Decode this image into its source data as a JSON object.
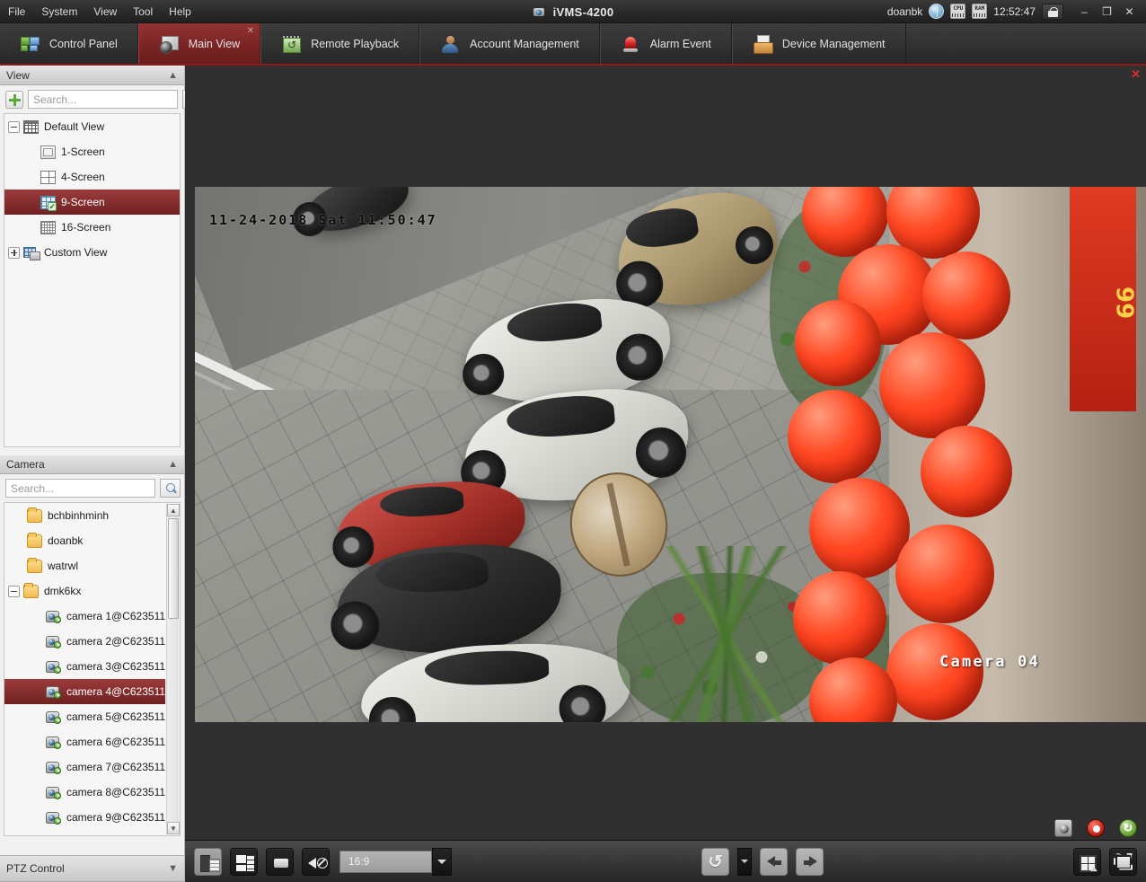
{
  "titlebar": {
    "menus": [
      {
        "label": "File"
      },
      {
        "label": "System"
      },
      {
        "label": "View"
      },
      {
        "label": "Tool"
      },
      {
        "label": "Help"
      }
    ],
    "app_title": "iVMS-4200",
    "logo_icon": "camera-logo-icon",
    "user": "doanbk",
    "status_icons": [
      "globe-icon",
      "cpu-icon",
      "ram-icon"
    ],
    "cpu_label": "CPU",
    "ram_label": "RAM",
    "clock": "12:52:47",
    "lock_icon": "lock-icon",
    "minimize": "–",
    "restore": "❐",
    "close": "✕"
  },
  "tabs": [
    {
      "label": "Control Panel",
      "icon": "control-panel-icon",
      "active": false,
      "closable": false
    },
    {
      "label": "Main View",
      "icon": "main-view-icon",
      "active": true,
      "closable": true,
      "close_glyph": "✕"
    },
    {
      "label": "Remote Playback",
      "icon": "remote-playback-icon",
      "active": false,
      "closable": false
    },
    {
      "label": "Account Management",
      "icon": "account-management-icon",
      "active": false,
      "closable": false
    },
    {
      "label": "Alarm Event",
      "icon": "alarm-event-icon",
      "active": false,
      "closable": false
    },
    {
      "label": "Device Management",
      "icon": "device-management-icon",
      "active": false,
      "closable": false
    }
  ],
  "view_panel": {
    "title": "View",
    "collapse_icon": "chevron-up-icon",
    "add_button_icon": "plus-icon",
    "search_placeholder": "Search...",
    "search_value": "",
    "search_icon": "magnifier-icon",
    "tree": [
      {
        "label": "Default View",
        "icon": "view-grid-icon",
        "expander": "minus",
        "depth": 0,
        "selected": false
      },
      {
        "label": "1-Screen",
        "icon": "screen-1-icon",
        "expander": "none",
        "depth": 1,
        "selected": false
      },
      {
        "label": "4-Screen",
        "icon": "screen-4-icon",
        "expander": "none",
        "depth": 1,
        "selected": false
      },
      {
        "label": "9-Screen",
        "icon": "screen-9-icon",
        "expander": "none",
        "depth": 1,
        "selected": true
      },
      {
        "label": "16-Screen",
        "icon": "screen-16-icon",
        "expander": "none",
        "depth": 1,
        "selected": false
      },
      {
        "label": "Custom View",
        "icon": "custom-view-icon",
        "expander": "plus",
        "depth": 0,
        "selected": false
      }
    ]
  },
  "camera_panel": {
    "title": "Camera",
    "collapse_icon": "chevron-up-icon",
    "search_placeholder": "Search...",
    "search_value": "",
    "search_icon": "magnifier-icon",
    "scroll_up_glyph": "▲",
    "scroll_down_glyph": "▼",
    "tree": [
      {
        "label": "bchbinhminh",
        "icon": "folder-icon",
        "expander": "none",
        "depth": 1,
        "selected": false
      },
      {
        "label": "doanbk",
        "icon": "folder-icon",
        "expander": "none",
        "depth": 1,
        "selected": false
      },
      {
        "label": "watrwl",
        "icon": "folder-icon",
        "expander": "none",
        "depth": 1,
        "selected": false
      },
      {
        "label": "dmk6kx",
        "icon": "folder-icon",
        "expander": "minus",
        "depth": 0,
        "selected": false
      },
      {
        "label": "camera 1@C623511...",
        "icon": "camera-icon",
        "expander": "none",
        "depth": 2,
        "selected": false
      },
      {
        "label": "camera 2@C623511...",
        "icon": "camera-icon",
        "expander": "none",
        "depth": 2,
        "selected": false
      },
      {
        "label": "camera 3@C623511...",
        "icon": "camera-icon",
        "expander": "none",
        "depth": 2,
        "selected": false
      },
      {
        "label": "camera 4@C623511...",
        "icon": "camera-icon",
        "expander": "none",
        "depth": 2,
        "selected": true
      },
      {
        "label": "camera 5@C623511...",
        "icon": "camera-icon",
        "expander": "none",
        "depth": 2,
        "selected": false
      },
      {
        "label": "camera 6@C623511...",
        "icon": "camera-icon",
        "expander": "none",
        "depth": 2,
        "selected": false
      },
      {
        "label": "camera 7@C623511...",
        "icon": "camera-icon",
        "expander": "none",
        "depth": 2,
        "selected": false
      },
      {
        "label": "camera 8@C623511...",
        "icon": "camera-icon",
        "expander": "none",
        "depth": 2,
        "selected": false
      },
      {
        "label": "camera 9@C623511...",
        "icon": "camera-icon",
        "expander": "none",
        "depth": 2,
        "selected": false
      }
    ]
  },
  "ptz_panel": {
    "title": "PTZ Control",
    "expand_icon": "chevron-down-icon"
  },
  "video": {
    "close_glyph": "✕",
    "timestamp": "11-24-2018 Sat 11:50:47",
    "camera_label": "Camera 04",
    "banner_text": "99",
    "overlay_tools": [
      {
        "icon": "capture-icon"
      },
      {
        "icon": "record-icon"
      },
      {
        "icon": "ptz-icon",
        "glyph": "↻"
      }
    ]
  },
  "bottom_toolbar": {
    "buttons_left": [
      {
        "icon": "save-view-icon",
        "state": "lit"
      },
      {
        "icon": "layout-icon",
        "state": "dark"
      },
      {
        "icon": "stop-all-icon",
        "state": "dark"
      },
      {
        "icon": "mute-icon",
        "state": "dark"
      }
    ],
    "aspect_ratio_value": "16:9",
    "aspect_ratio_arrow": "chevron-down-icon",
    "buttons_center": [
      {
        "icon": "auto-switch-icon",
        "state": "grey"
      },
      {
        "icon": "auto-switch-dropdown-icon",
        "state": "arrow"
      },
      {
        "icon": "previous-page-icon",
        "state": "grey"
      },
      {
        "icon": "next-page-icon",
        "state": "grey"
      }
    ],
    "buttons_right": [
      {
        "icon": "window-division-icon",
        "state": "dark"
      },
      {
        "icon": "fullscreen-icon",
        "state": "dark"
      }
    ]
  },
  "colors": {
    "accent_red": "#7b2424",
    "titlebar_dark": "#2b2b2b",
    "video_bg": "#303030",
    "sidebar_bg": "#f1f1f1",
    "selection_red": "#8e2d2d"
  }
}
